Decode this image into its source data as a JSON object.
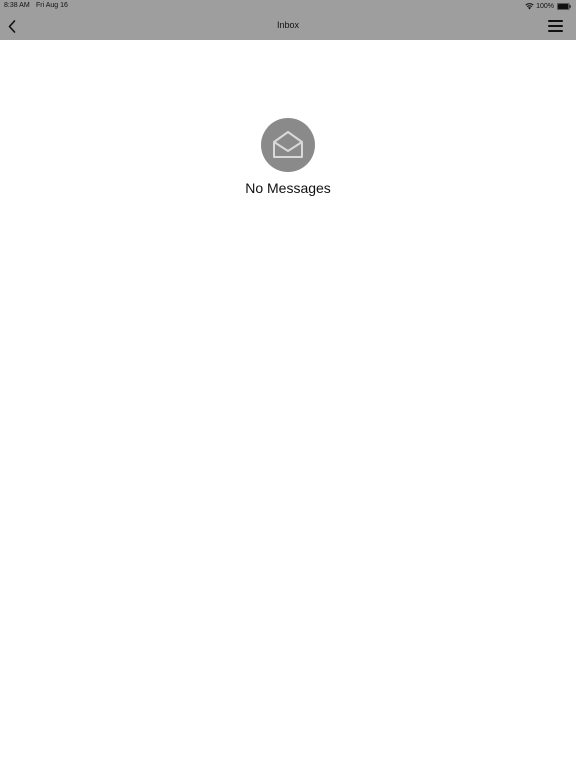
{
  "status_bar": {
    "time": "8:38 AM",
    "date": "Fri Aug 16",
    "battery": "100%",
    "wifi_icon": "wifi-icon",
    "battery_icon": "battery-full-icon"
  },
  "navbar": {
    "title": "Inbox",
    "back_icon": "chevron-left-icon",
    "menu_icon": "hamburger-menu-icon",
    "background_color": "#9e9e9e"
  },
  "empty_state": {
    "icon": "open-envelope-icon",
    "message": "No Messages",
    "badge_color": "#8a8a8a"
  }
}
